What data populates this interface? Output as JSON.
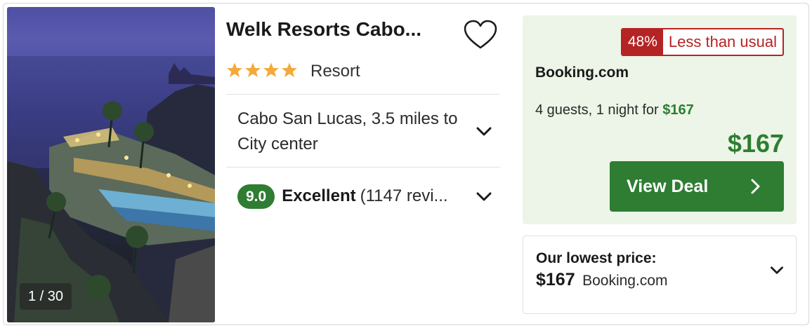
{
  "photo": {
    "counter": "1 / 30"
  },
  "hotel": {
    "name": "Welk Resorts Cabo...",
    "stars": 4,
    "type": "Resort",
    "location": "Cabo San Lucas, 3.5 miles to City center",
    "score": "9.0",
    "rating_word": "Excellent",
    "review_count": "(1147 revi..."
  },
  "deal": {
    "discount_pct": "48%",
    "discount_label": "Less than usual",
    "provider": "Booking.com",
    "guests_text": "4 guests, 1 night for",
    "guests_price": "$167",
    "price": "$167",
    "button_label": "View Deal"
  },
  "lowest": {
    "heading": "Our lowest price:",
    "price": "$167",
    "provider": "Booking.com"
  },
  "colors": {
    "accent_green": "#2e7d32",
    "deal_bg": "#ecf5e7",
    "badge_red": "#b52424",
    "star_orange": "#f4a93a"
  }
}
